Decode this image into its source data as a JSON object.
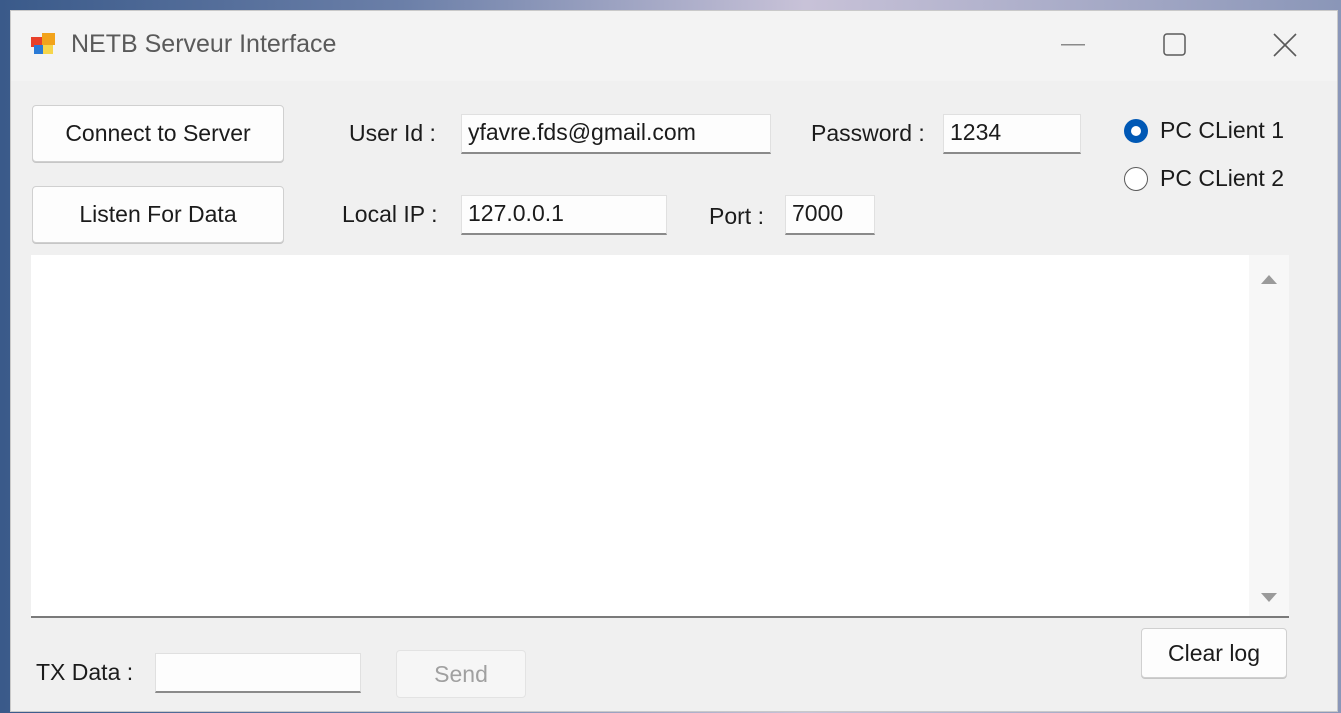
{
  "window": {
    "title": "NETB Serveur Interface"
  },
  "buttons": {
    "connect": "Connect to Server",
    "listen": "Listen For Data",
    "send": "Send",
    "clear_log": "Clear log"
  },
  "fields": {
    "user_id_label": "User Id :",
    "user_id_value": "yfavre.fds@gmail.com",
    "password_label": "Password :",
    "password_value": "1234",
    "local_ip_label": "Local IP :",
    "local_ip_value": "127.0.0.1",
    "port_label": "Port :",
    "port_value": "7000",
    "tx_data_label": "TX Data :",
    "tx_data_value": ""
  },
  "radio": {
    "options": [
      "PC CLient 1",
      "PC CLient 2"
    ],
    "selected": "PC CLient 1"
  },
  "colors": {
    "accent": "#0058b5"
  }
}
